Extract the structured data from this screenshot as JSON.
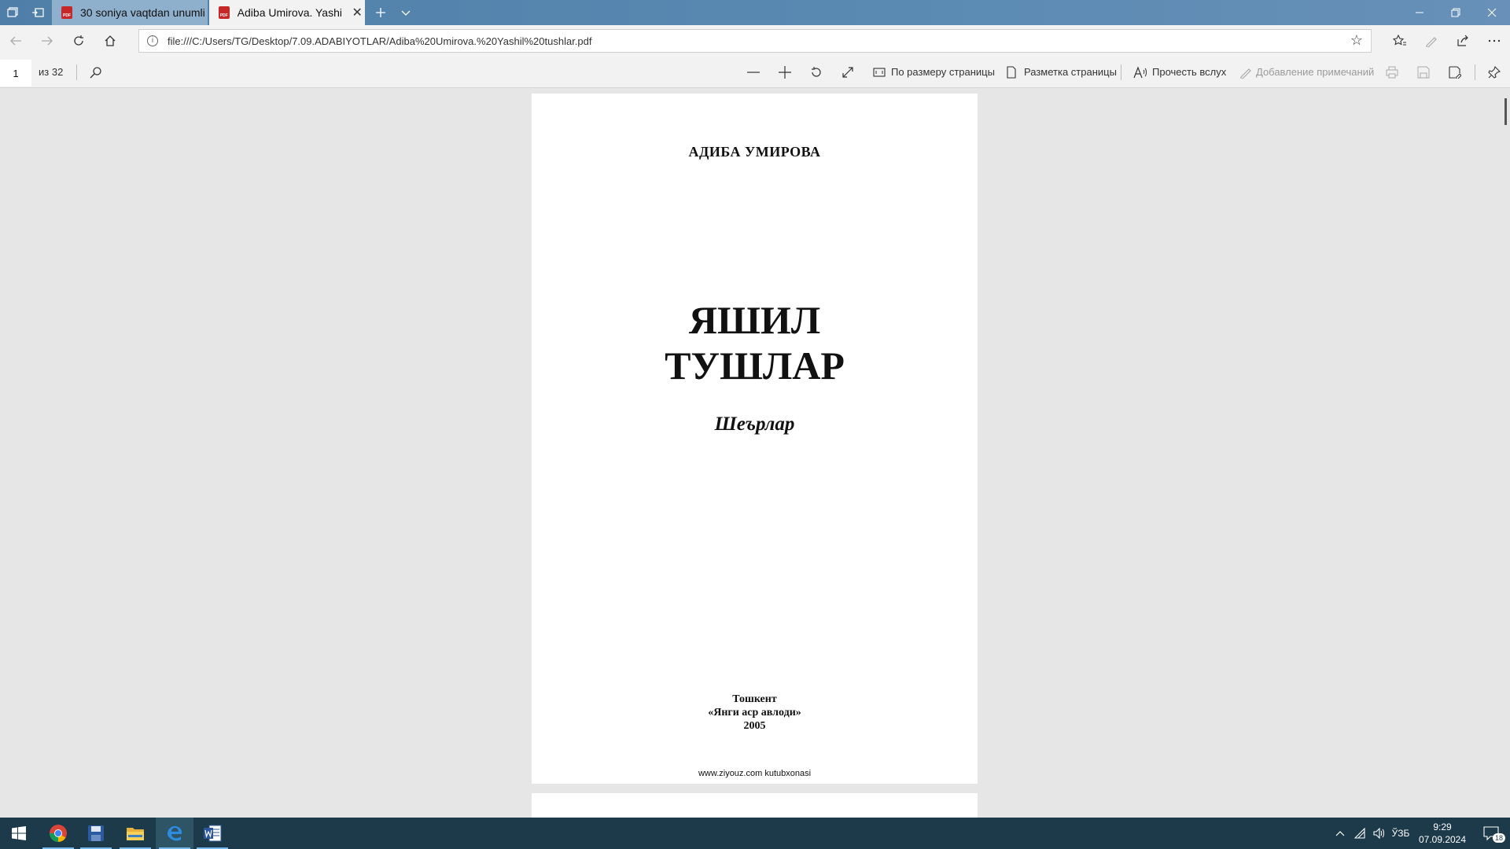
{
  "browser": {
    "tabs": [
      {
        "label": "30 soniya vaqtdan unumli fo",
        "active": false,
        "icon": "pdf-icon"
      },
      {
        "label": "Adiba Umirova. Yashil tu",
        "active": true,
        "icon": "pdf-icon"
      }
    ],
    "url": "file:///C:/Users/TG/Desktop/7.09.ADABIYOTLAR/Adiba%20Umirova.%20Yashil%20tushlar.pdf"
  },
  "pdf_toolbar": {
    "page_number": "1",
    "page_count": "из 32",
    "fit_page": "По размеру страницы",
    "page_layout": "Разметка страницы",
    "read_aloud": "Прочесть вслух",
    "add_notes": "Добавление примечаний"
  },
  "page": {
    "author": "АДИБА УМИРОВА",
    "title_line1": "ЯШИЛ",
    "title_line2": "ТУШЛАР",
    "subtitle": "Шеърлар",
    "city": "Тошкент",
    "publisher": "«Янги аср авлоди»",
    "year": "2005",
    "footer": "www.ziyouz.com kutubxonasi"
  },
  "taskbar": {
    "apps": [
      "chrome-icon",
      "save-icon",
      "file-explorer-icon",
      "edge-icon",
      "word-icon"
    ],
    "language": "ЎЗБ",
    "time": "9:29",
    "date": "07.09.2024",
    "notifications": "18"
  },
  "colors": {
    "tabbar": "#4f7fa8",
    "toolbar": "#f2f2f2",
    "viewer_bg": "#e6e6e6",
    "taskbar": "#1c3a4a",
    "pdf_red": "#c62828"
  }
}
